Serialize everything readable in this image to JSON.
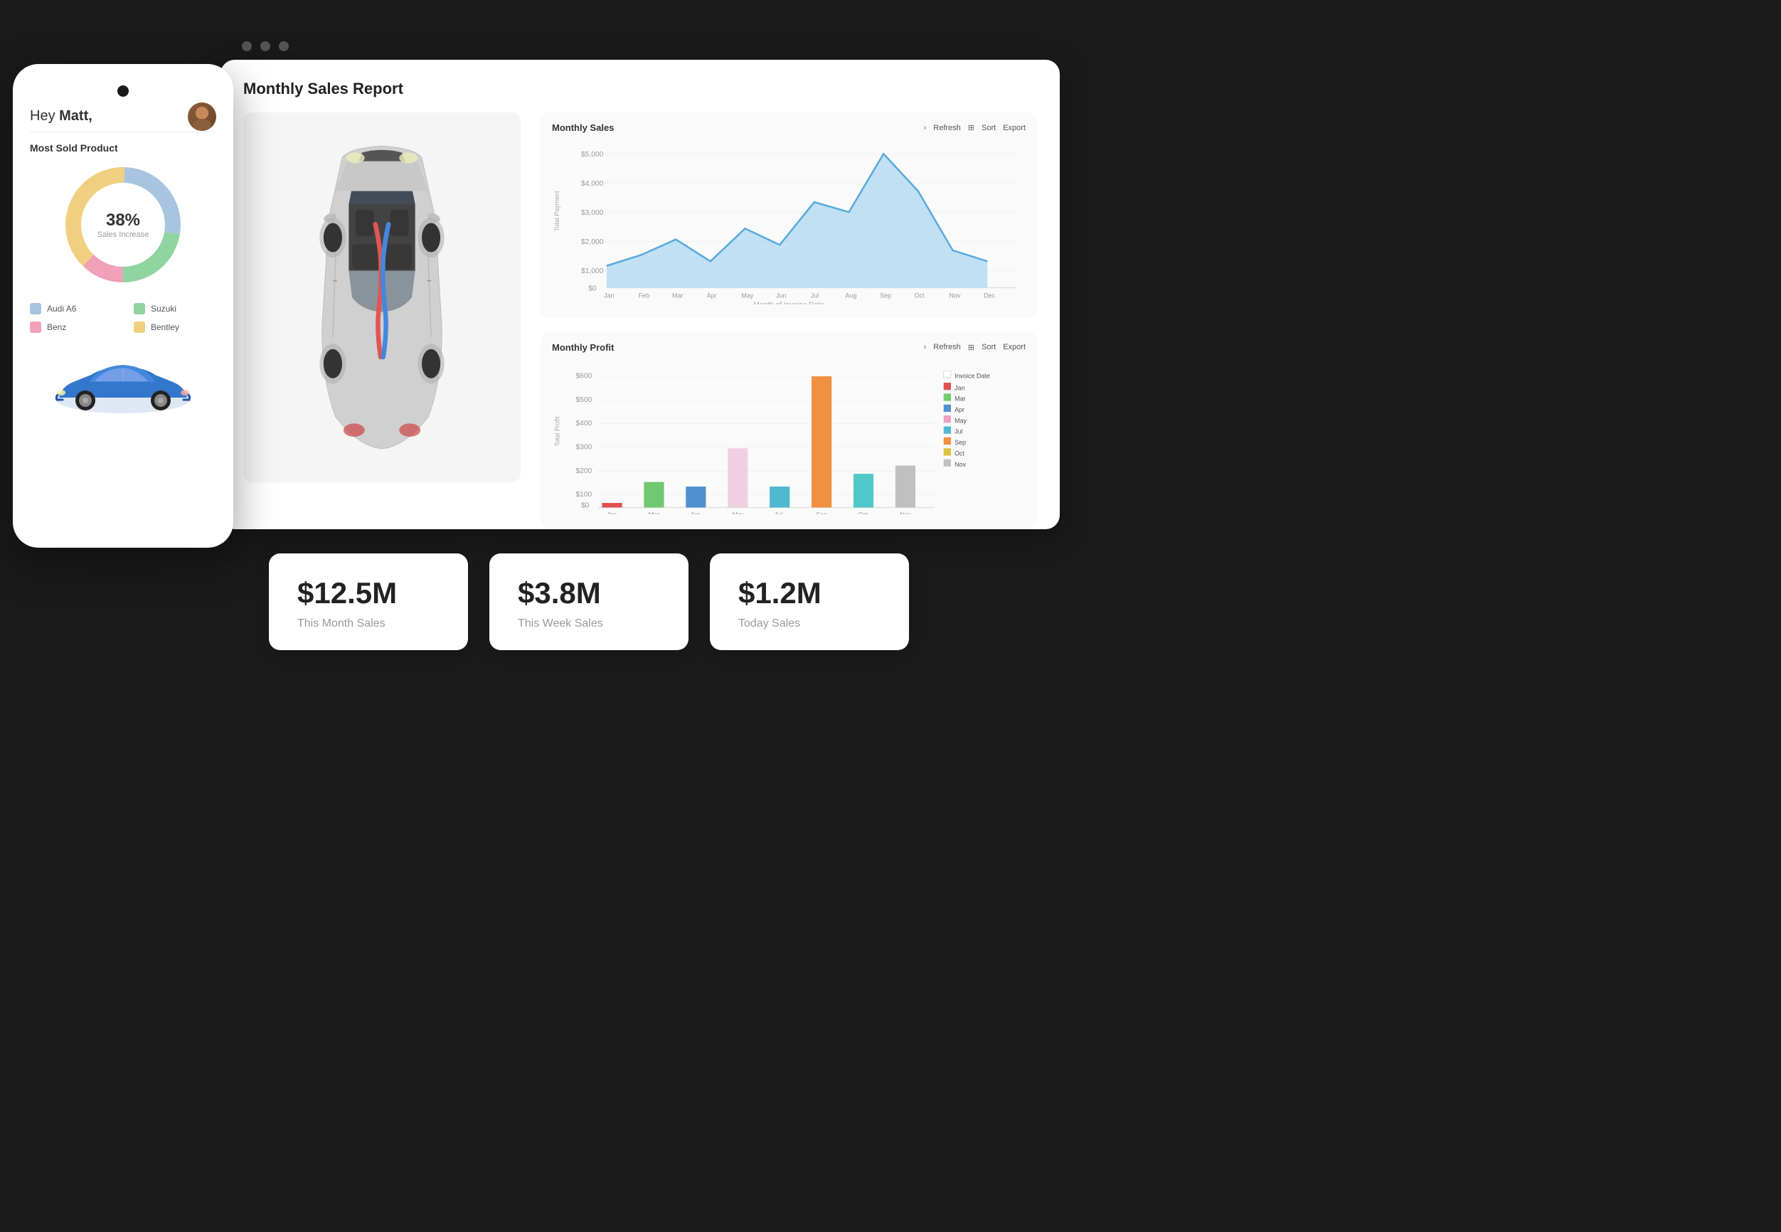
{
  "phone": {
    "greeting": "Hey ",
    "name": "Matt,",
    "most_sold_title": "Most Sold Product",
    "donut_percent": "38%",
    "donut_label": "Sales Increase",
    "legend": [
      {
        "label": "Audi A6",
        "color": "#a8c4e0"
      },
      {
        "label": "Suzuki",
        "color": "#90d4a0"
      },
      {
        "label": "Benz",
        "color": "#f0a0b8"
      },
      {
        "label": "Bentley",
        "color": "#f0d080"
      }
    ]
  },
  "dashboard": {
    "title": "Monthly Sales Report",
    "monthly_sales": {
      "title": "Monthly Sales",
      "refresh_label": "Refresh",
      "sort_label": "Sort",
      "export_label": "Export",
      "x_axis_label": "Month of Invoice Date",
      "y_axis_label": "Total Payment",
      "months": [
        "Jan",
        "Feb",
        "Mar",
        "Apr",
        "May",
        "Jun",
        "Jul",
        "Aug",
        "Sep",
        "Oct",
        "Nov",
        "Dec"
      ],
      "values": [
        800,
        1200,
        1800,
        1000,
        2200,
        1600,
        3200,
        2800,
        5000,
        3800,
        1400,
        1000
      ]
    },
    "monthly_profit": {
      "title": "Monthly Profit",
      "refresh_label": "Refresh",
      "sort_label": "Sort",
      "export_label": "Export",
      "checkbox_label": "Invoice Date",
      "months": [
        "Jan",
        "Mar",
        "Apr",
        "May",
        "Jul",
        "Sep",
        "Oct",
        "Nov"
      ],
      "legend": [
        {
          "label": "Jan",
          "color": "#e05050"
        },
        {
          "label": "Mar",
          "color": "#70c870"
        },
        {
          "label": "Apr",
          "color": "#5090d0"
        },
        {
          "label": "May",
          "color": "#d04090"
        },
        {
          "label": "Jul",
          "color": "#50b8d0"
        },
        {
          "label": "Sep",
          "color": "#f09040"
        },
        {
          "label": "Oct",
          "color": "#e0c040"
        },
        {
          "label": "Nov",
          "color": "#c0c0c0"
        }
      ],
      "values": [
        20,
        120,
        100,
        280,
        100,
        620,
        160,
        200
      ]
    }
  },
  "stats": [
    {
      "value": "$12.5M",
      "label": "This Month Sales"
    },
    {
      "value": "$3.8M",
      "label": "This Week Sales"
    },
    {
      "value": "$1.2M",
      "label": "Today Sales"
    }
  ],
  "three_dots": true
}
